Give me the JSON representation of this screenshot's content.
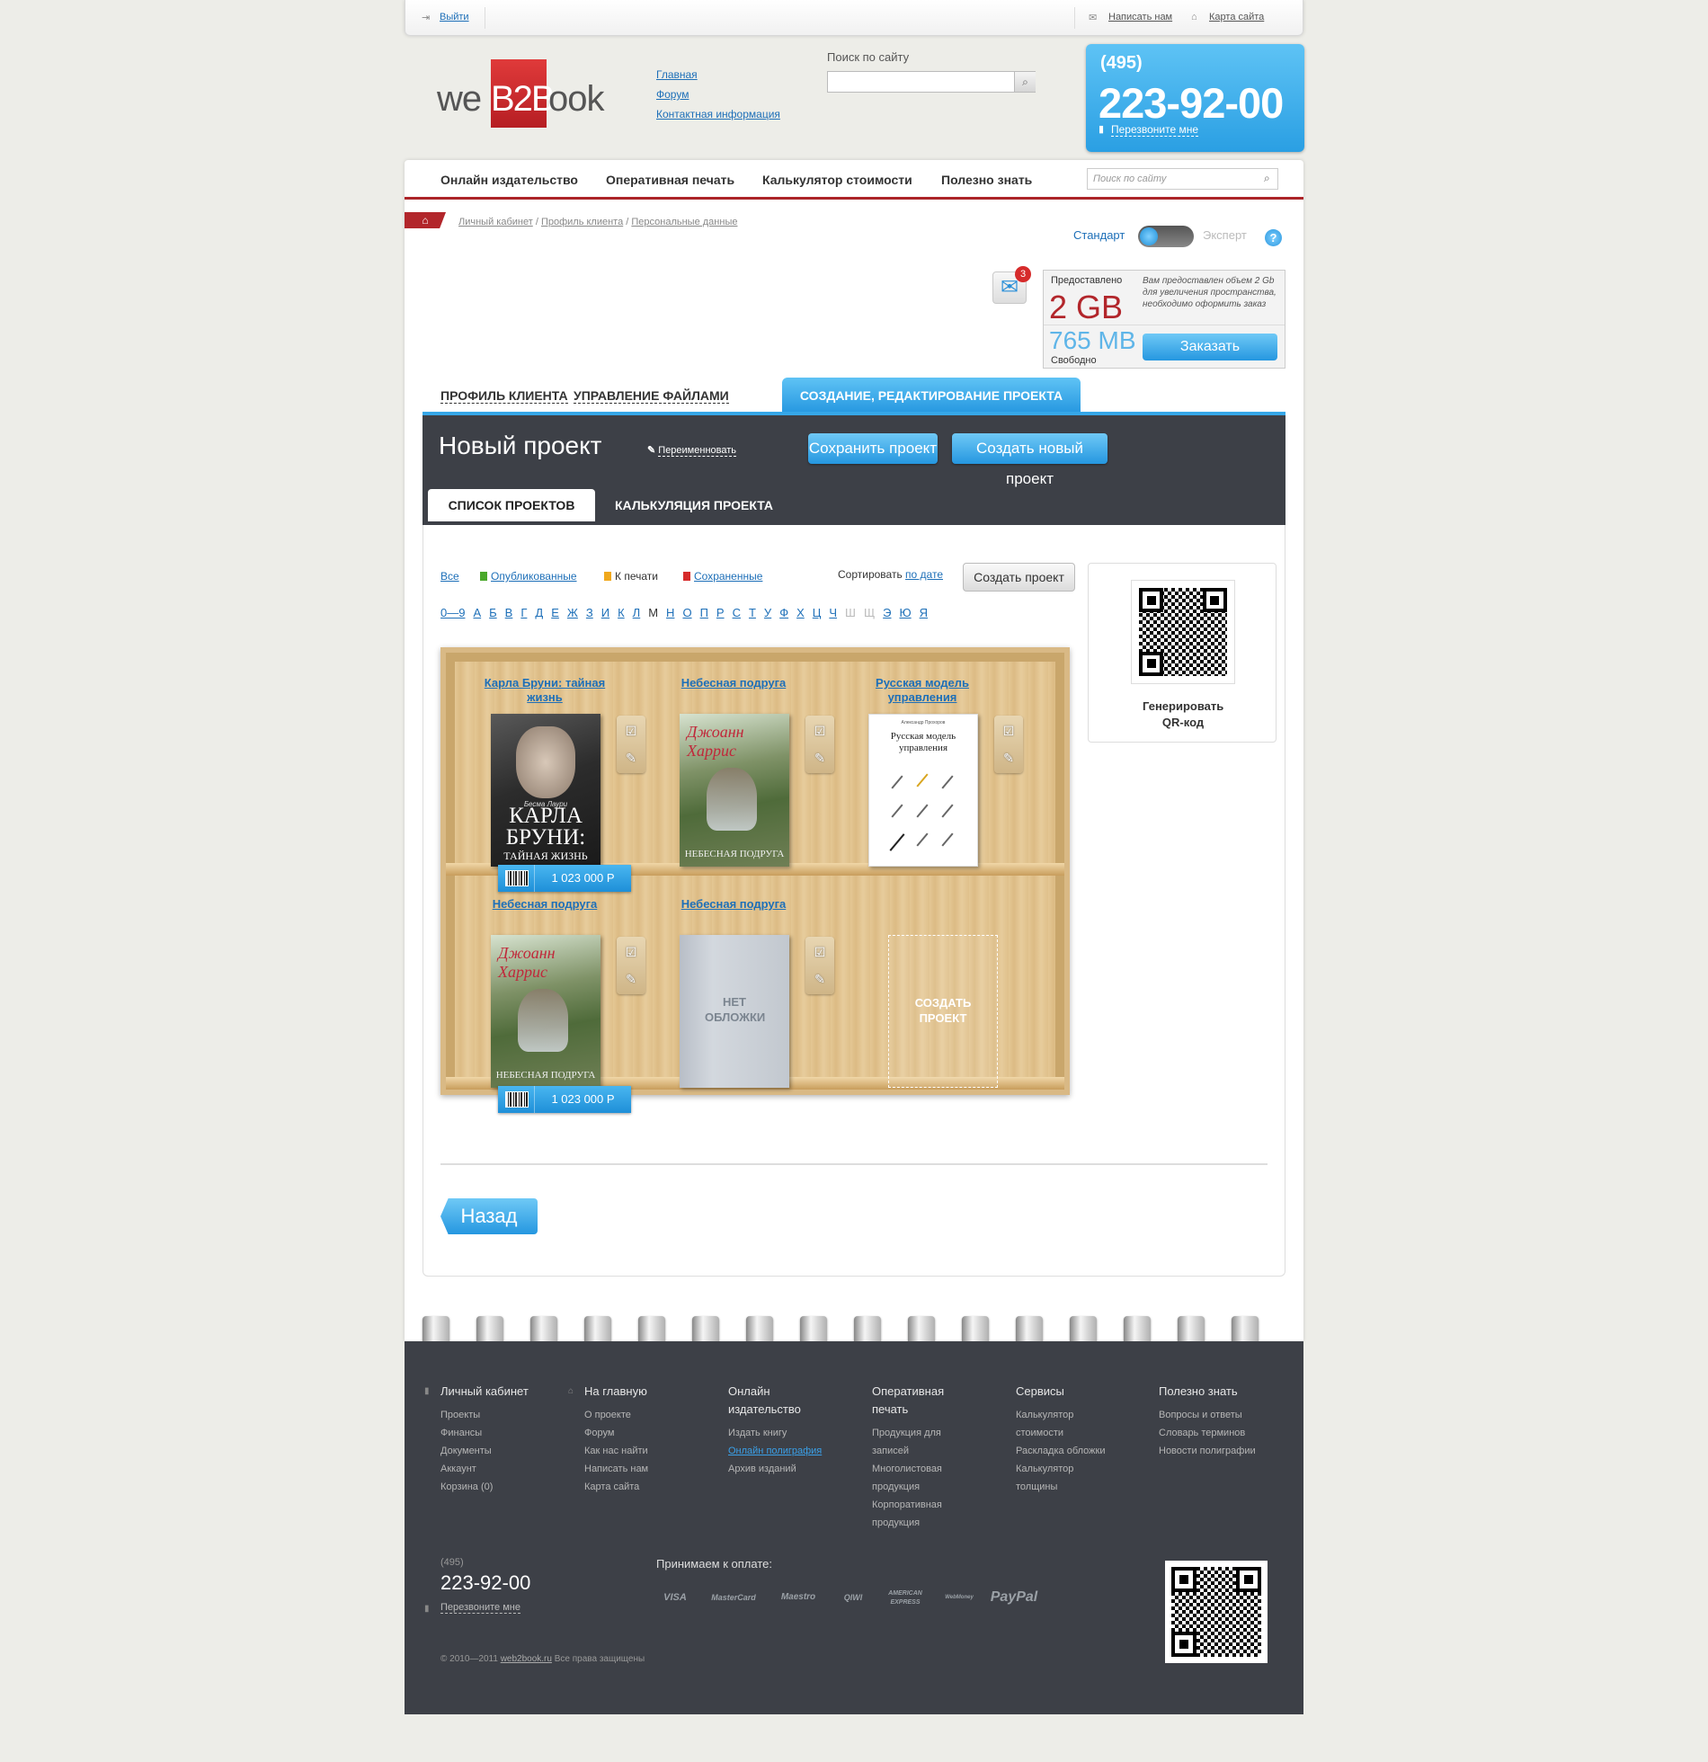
{
  "topbar": {
    "logout": "Выйти",
    "write_us": "Написать нам",
    "sitemap": "Карта сайта"
  },
  "header": {
    "logo_we": "we",
    "logo_b2b": "B2B",
    "logo_ook": "ook",
    "links": [
      "Главная",
      "Форум",
      "Контактная информация"
    ],
    "search_label": "Поиск по сайту",
    "search_value": "",
    "phone_code": "(495)",
    "phone_number": "223-92-00",
    "callback": "Перезвоните мне"
  },
  "nav": {
    "items": [
      "Онлайн издательство",
      "Оперативная печать",
      "Калькулятор стоимости",
      "Полезно знать"
    ],
    "search_placeholder": "Поиск по сайту"
  },
  "breadcrumb": [
    "Личный кабинет",
    "Профиль клиента",
    "Персональные данные"
  ],
  "mode": {
    "standard": "Стандарт",
    "expert": "Эксперт"
  },
  "mail": {
    "count": "3"
  },
  "storage": {
    "provided_label": "Предоставлено",
    "provided_value": "2 GB",
    "note": "Вам предоставлен объем 2 Gb для увеличения пространства, необходимо оформить заказ",
    "free_value": "765 MB",
    "free_label": "Свободно",
    "order_button": "Заказать"
  },
  "profile_tabs": {
    "profile": "ПРОФИЛЬ КЛИЕНТА",
    "files": "УПРАВЛЕНИЕ ФАЙЛАМИ",
    "project": "СОЗДАНИЕ, РЕДАКТИРОВАНИЕ ПРОЕКТА"
  },
  "project": {
    "title": "Новый проект",
    "rename": "Переименновать",
    "save_button": "Сохранить проект",
    "new_button": "Создать новый проект",
    "subtab_list": "СПИСОК ПРОЕКТОВ",
    "subtab_calc": "КАЛЬКУЛЯЦИЯ ПРОЕКТА"
  },
  "filters": {
    "all": "Все",
    "published": "Опубликованные",
    "to_print": "К печати",
    "saved": "Сохраненные",
    "sort_label": "Сортировать",
    "sort_value": "по дате",
    "create_button": "Создать проект",
    "colors": {
      "published": "#4aa82a",
      "to_print": "#f0a81c",
      "saved": "#d62b2b"
    }
  },
  "alphabet": [
    {
      "c": "0—9",
      "s": "lk"
    },
    {
      "c": "А",
      "s": "lk"
    },
    {
      "c": "Б",
      "s": "lk"
    },
    {
      "c": "В",
      "s": "lk"
    },
    {
      "c": "Г",
      "s": "lk"
    },
    {
      "c": "Д",
      "s": "lk"
    },
    {
      "c": "Е",
      "s": "lk"
    },
    {
      "c": "Ж",
      "s": "lk"
    },
    {
      "c": "З",
      "s": "lk"
    },
    {
      "c": "И",
      "s": "lk"
    },
    {
      "c": "К",
      "s": "lk"
    },
    {
      "c": "Л",
      "s": "lk"
    },
    {
      "c": "М",
      "s": "cur"
    },
    {
      "c": "Н",
      "s": "lk"
    },
    {
      "c": "О",
      "s": "lk"
    },
    {
      "c": "П",
      "s": "lk"
    },
    {
      "c": "Р",
      "s": "lk"
    },
    {
      "c": "С",
      "s": "lk"
    },
    {
      "c": "Т",
      "s": "lk"
    },
    {
      "c": "У",
      "s": "lk"
    },
    {
      "c": "Ф",
      "s": "lk"
    },
    {
      "c": "Х",
      "s": "lk"
    },
    {
      "c": "Ц",
      "s": "lk"
    },
    {
      "c": "Ч",
      "s": "lk"
    },
    {
      "c": "Ш",
      "s": "dis"
    },
    {
      "c": "Щ",
      "s": "dis"
    },
    {
      "c": "Э",
      "s": "lk"
    },
    {
      "c": "Ю",
      "s": "lk"
    },
    {
      "c": "Я",
      "s": "lk"
    }
  ],
  "books": {
    "b1_title": "Карла Бруни: тайная жизнь",
    "b1_cover_author": "Бесма Лаури",
    "b1_cover_title": "КАРЛА БРУНИ:",
    "b1_cover_sub": "ТАЙНАЯ ЖИЗНЬ",
    "b1_price": "1 023 000 Р",
    "b2_title": "Небесная подруга",
    "b2_cover_author": "Джоанн Харрис",
    "b2_cover_title": "НЕБЕСНАЯ ПОДРУГА",
    "b3_title": "Русская модель управления",
    "b3_cover_author": "Александр Прохоров",
    "b3_cover_title": "Русская модель управления",
    "b4_title": "Небесная подруга",
    "b4_price": "1 023 000 Р",
    "b5_title": "Небесная подруга",
    "b5_no_cover": "НЕТ ОБЛОЖКИ",
    "b6_create": "СОЗДАТЬ ПРОЕКТ"
  },
  "qr": {
    "label": "Генерировать QR-код"
  },
  "back_button": "Назад",
  "footer": {
    "cols": [
      {
        "title": "Личный кабинет",
        "items": [
          "Проекты",
          "Финансы",
          "Документы",
          "Аккаунт",
          "Корзина (0)"
        ]
      },
      {
        "title": "На главную",
        "items": [
          "О проекте",
          "Форум",
          "Как нас найти",
          "Написать нам",
          "Карта сайта"
        ]
      },
      {
        "title": "Онлайн издательство",
        "items": [
          "Издать книгу",
          "Онлайн полиграфия",
          "Архив изданий"
        ]
      },
      {
        "title": "Оперативная печать",
        "items": [
          "Продукция для записей",
          "Многолистовая продукция",
          "Корпоративная продукция"
        ]
      },
      {
        "title": "Сервисы",
        "items": [
          "Калькулятор стоимости",
          "Раскладка обложки",
          "Калькулятор толщины"
        ]
      },
      {
        "title": "Полезно знать",
        "items": [
          "Вопросы и ответы",
          "Словарь терминов",
          "Новости полиграфии"
        ]
      }
    ],
    "phone_code": "(495)",
    "phone": "223-92-00",
    "callback": "Перезвоните мне",
    "pay_label": "Принимаем к оплате:",
    "pay_icons": [
      "VISA",
      "MasterCard",
      "Maestro",
      "QIWI",
      "AMERICAN EXPRESS",
      "WebMoney",
      "PayPal"
    ],
    "copyright": "2010—2011",
    "site": "web2book.ru",
    "rights": "Все права защищены"
  }
}
